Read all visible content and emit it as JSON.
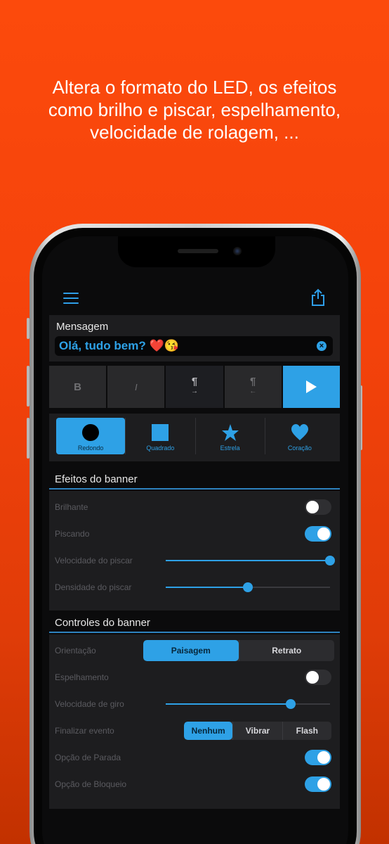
{
  "headline": {
    "lines": [
      "Altera o formato do LED, os efeitos",
      "como brilho e piscar, espelhamento,",
      "velocidade de rolagem, ..."
    ]
  },
  "colors": {
    "accent": "#2ea1e6",
    "background_orange": "#fc4a0c",
    "panel": "#1d1d1f"
  },
  "icons": {
    "menu": "hamburger-icon",
    "share": "share-icon",
    "clear": "clear-icon",
    "play": "play-icon",
    "settings": "sliders-icon",
    "info": "info-icon"
  },
  "message": {
    "label": "Mensagem",
    "value": "Olá, tudo bem? ❤️😘"
  },
  "format": {
    "bold": "B",
    "italic": "I",
    "pilcrow_right": "¶",
    "pilcrow_left": "¶"
  },
  "shapes": [
    {
      "label": "Redondo",
      "active": true
    },
    {
      "label": "Quadrado",
      "active": false
    },
    {
      "label": "Estrela",
      "active": false
    },
    {
      "label": "Coração",
      "active": false
    }
  ],
  "effects": {
    "title": "Efeitos do banner",
    "brilhante": {
      "label": "Brilhante",
      "on": false
    },
    "piscando": {
      "label": "Piscando",
      "on": true
    },
    "velocidade_piscar": {
      "label": "Velocidade do piscar",
      "value": 1.0
    },
    "densidade_piscar": {
      "label": "Densidade do piscar",
      "value": 0.5
    }
  },
  "controls": {
    "title": "Controles do banner",
    "orientacao": {
      "label": "Orientação",
      "options": [
        "Paisagem",
        "Retrato"
      ],
      "selected": "Paisagem"
    },
    "espelhamento": {
      "label": "Espelhamento",
      "on": false
    },
    "velocidade_giro": {
      "label": "Velocidade de giro",
      "value": 0.76
    },
    "finalizar_evento": {
      "label": "Finalizar evento",
      "options": [
        "Nenhum",
        "Vibrar",
        "Flash"
      ],
      "selected": "Nenhum"
    },
    "opcao_parada": {
      "label": "Opção de Parada",
      "on": true
    },
    "opcao_bloqueio": {
      "label": "Opção de Bloqueio",
      "on": true
    }
  }
}
